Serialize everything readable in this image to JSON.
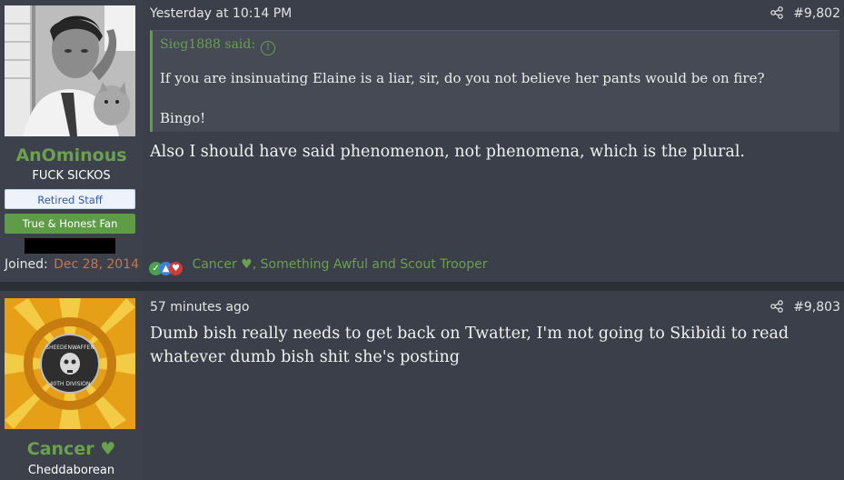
{
  "posts": [
    {
      "author": "AnOminous",
      "user_title": "FUCK SICKOS",
      "banners": [
        "Retired Staff",
        "True & Honest Fan"
      ],
      "joined_label": "Joined:",
      "joined_date": "Dec 28, 2014",
      "time": "Yesterday at 10:14 PM",
      "post_number": "#9,802",
      "quote": {
        "author_label": "Sieg1888 said:",
        "lines": [
          "If you are insinuating Elaine is a liar, sir, do you not believe her pants would be on fire?",
          "Bingo!"
        ]
      },
      "body": "Also I should have said phenomenon, not phenomena, which is the plural.",
      "reactions_text": "Cancer ♥, Something Awful and Scout Trooper"
    },
    {
      "author": "Cancer ♥",
      "user_title": "Cheddaborean",
      "avatar_text_top": "SHEEDENWAFFEN",
      "avatar_text_bottom": "40TH DIVISION",
      "time": "57 minutes ago",
      "post_number": "#9,803",
      "body": "Dumb bish really needs to get back on Twatter, I'm not going to Skibidi to read whatever dumb bish shit she's posting"
    }
  ],
  "colors": {
    "accent_green": "#6aa04e",
    "joined_date": "#c6764c",
    "background": "#353a45"
  },
  "icons": [
    "share-icon",
    "quote-jump-icon",
    "reaction-check-icon",
    "reaction-like-icon",
    "reaction-heart-icon"
  ]
}
